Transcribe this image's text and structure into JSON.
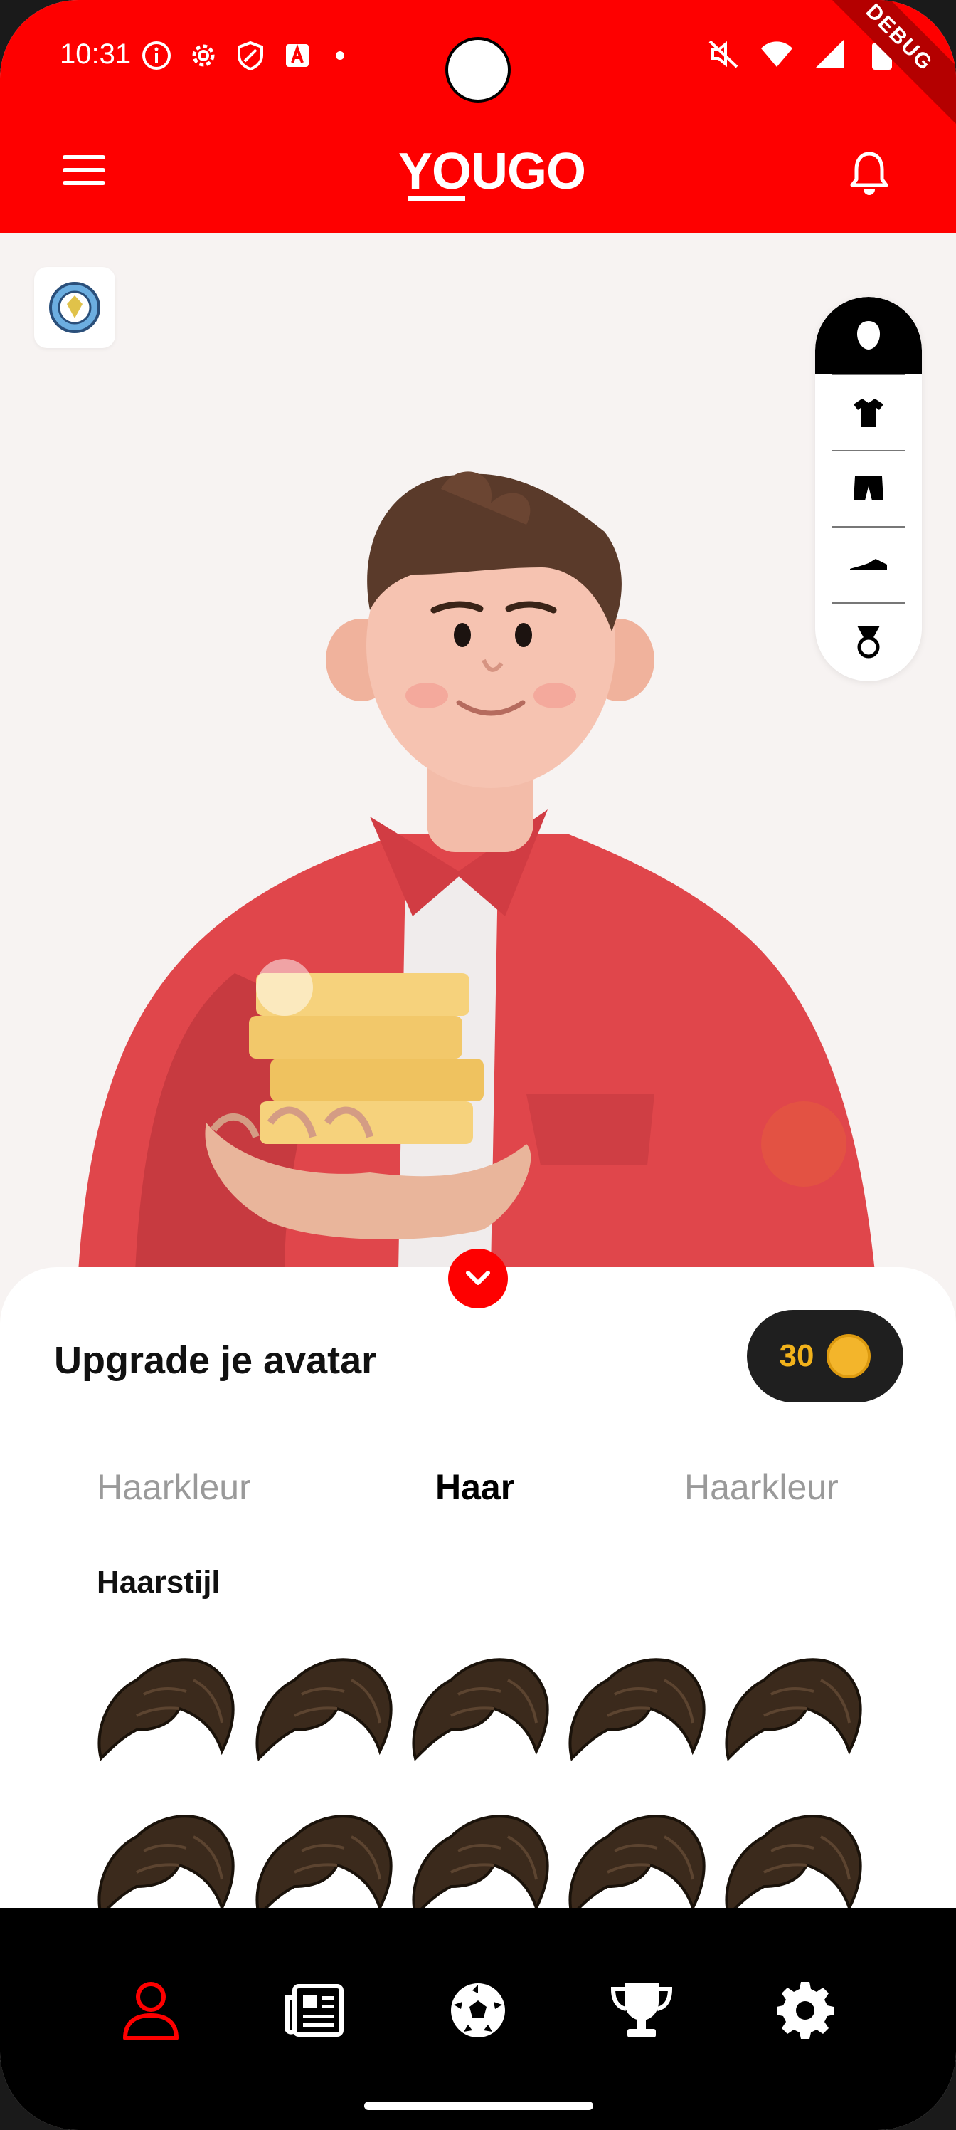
{
  "status_bar": {
    "time": "10:31",
    "debug_banner": "DEBUG"
  },
  "app_bar": {
    "logo": "YOUGO",
    "menu_icon": "menu-icon",
    "bell_icon": "bell-icon"
  },
  "stage": {
    "club_badge": "club-crest",
    "side_picker": [
      {
        "icon": "head-icon",
        "active": true
      },
      {
        "icon": "shirt-icon",
        "active": false
      },
      {
        "icon": "shorts-icon",
        "active": false
      },
      {
        "icon": "boot-icon",
        "active": false
      },
      {
        "icon": "medal-icon",
        "active": false
      }
    ]
  },
  "sheet": {
    "title": "Upgrade je avatar",
    "coins": "30",
    "tabs": [
      {
        "label": "Haarkleur",
        "active": false
      },
      {
        "label": "Haar",
        "active": true
      },
      {
        "label": "Haarkleur",
        "active": false
      }
    ],
    "section_title": "Haarstijl",
    "hair_styles_count_visible": 10
  },
  "bottom_nav": [
    {
      "icon": "profile-icon",
      "active": true
    },
    {
      "icon": "news-icon",
      "active": false
    },
    {
      "icon": "football-icon",
      "active": false
    },
    {
      "icon": "trophy-icon",
      "active": false
    },
    {
      "icon": "settings-icon",
      "active": false
    }
  ],
  "colors": {
    "brand_red": "#fe0000",
    "coin_gold": "#f2b21b",
    "nav_active": "#fe0000",
    "nav_inactive": "#ffffff"
  }
}
